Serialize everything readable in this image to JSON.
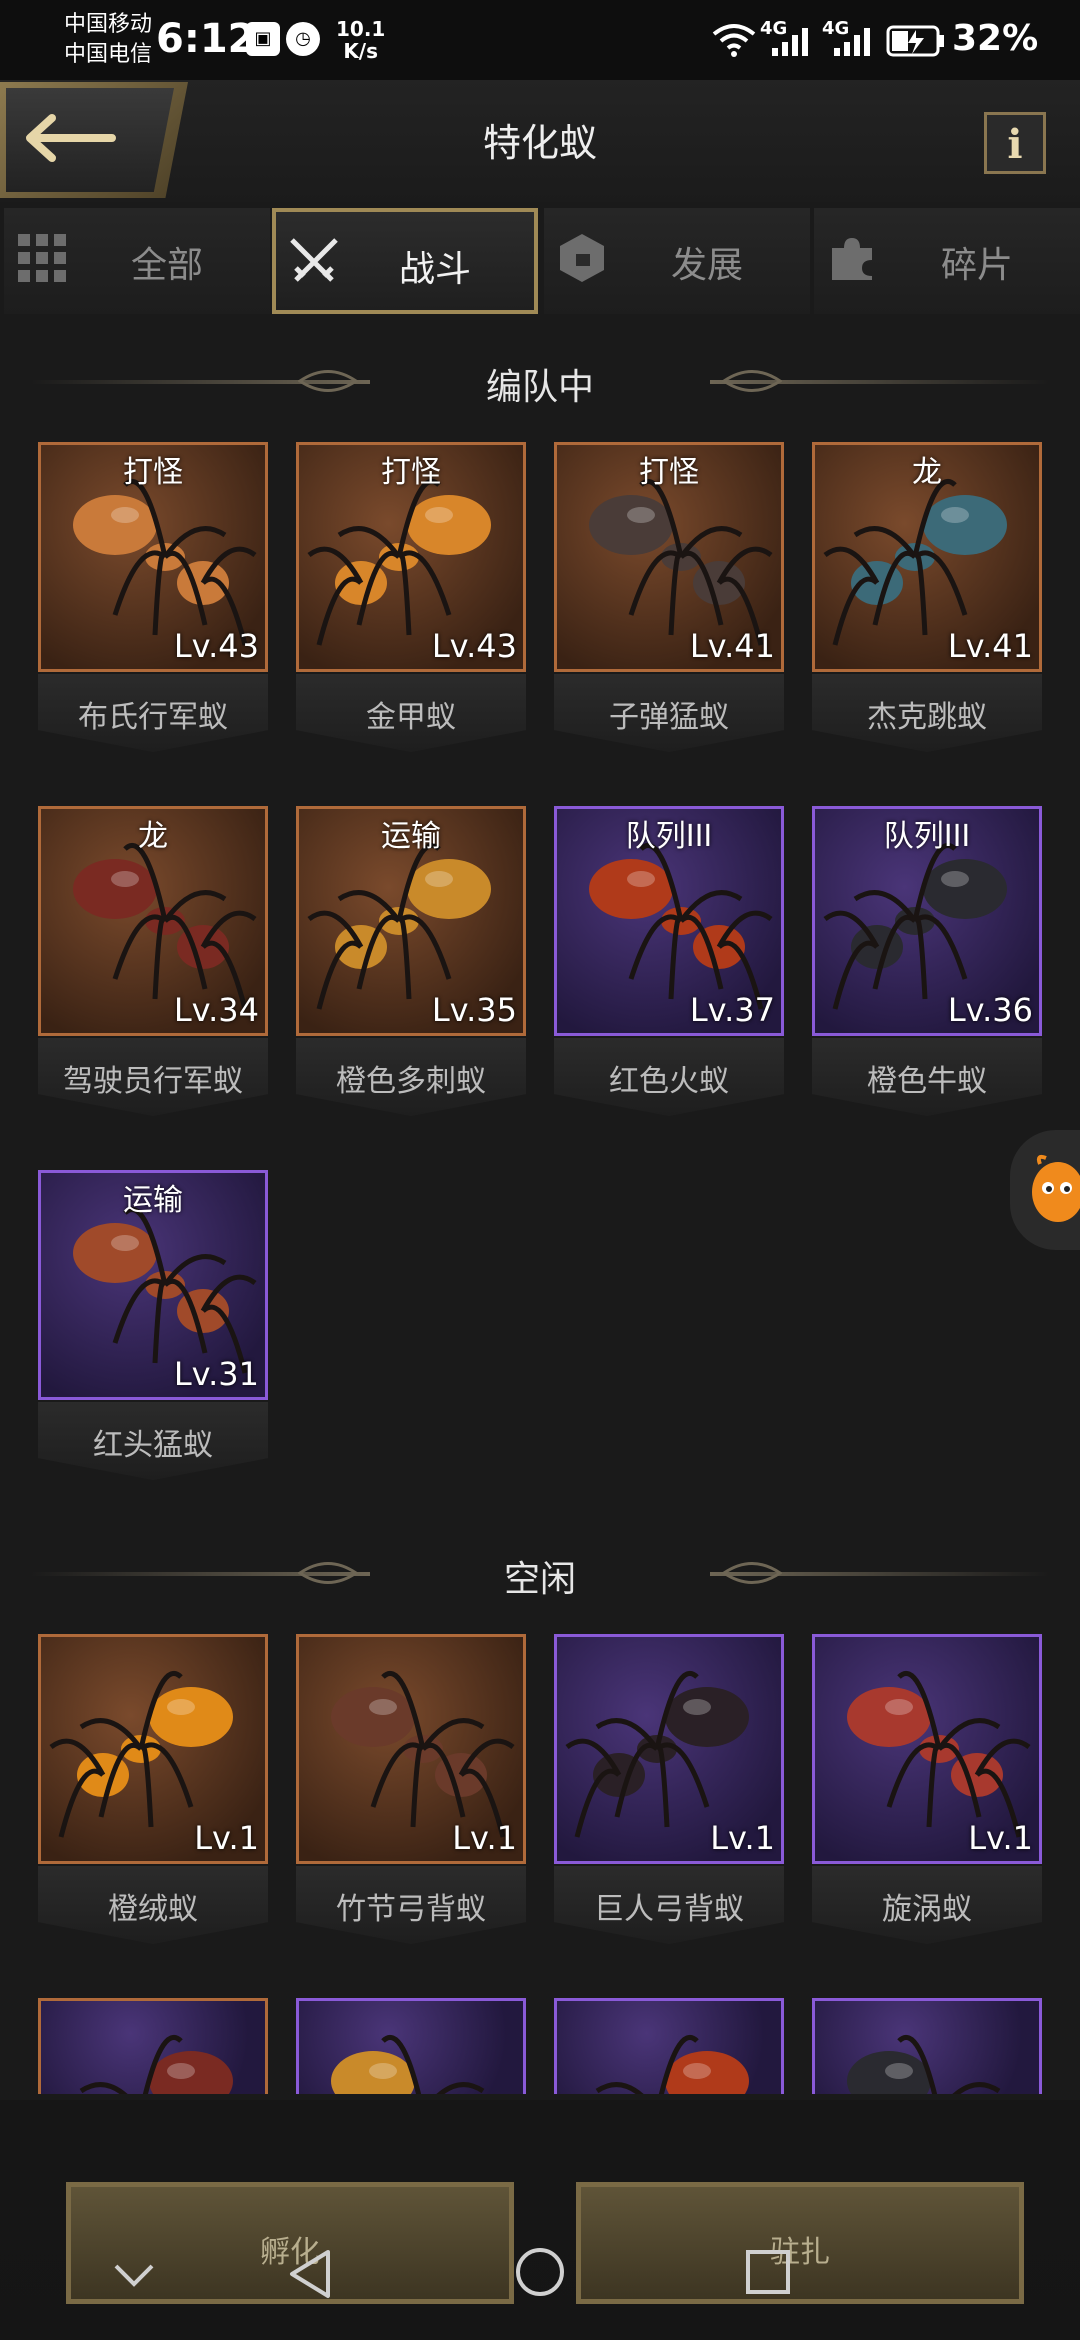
{
  "status_bar": {
    "carrier1": "中国移动",
    "carrier2": "中国电信",
    "time": "6:12",
    "net_speed_value": "10.1",
    "net_speed_unit": "K/s",
    "signal1": "4G",
    "signal2": "4G",
    "battery": "32%"
  },
  "header": {
    "title": "特化蚁",
    "info_label": "i"
  },
  "tabs": [
    {
      "label": "全部",
      "icon": "grid-icon",
      "active": false
    },
    {
      "label": "战斗",
      "icon": "crossed-swords-icon",
      "active": true
    },
    {
      "label": "发展",
      "icon": "hexagon-icon",
      "active": false
    },
    {
      "label": "碎片",
      "icon": "puzzle-icon",
      "active": false
    }
  ],
  "sections": {
    "in_team": "编队中",
    "idle": "空闲"
  },
  "team_ants": [
    {
      "tag": "打怪",
      "level": "Lv.43",
      "name": "布氏行军蚁",
      "rarity": "orange"
    },
    {
      "tag": "打怪",
      "level": "Lv.43",
      "name": "金甲蚁",
      "rarity": "orange"
    },
    {
      "tag": "打怪",
      "level": "Lv.41",
      "name": "子弹猛蚁",
      "rarity": "orange"
    },
    {
      "tag": "龙",
      "level": "Lv.41",
      "name": "杰克跳蚁",
      "rarity": "orange"
    },
    {
      "tag": "龙",
      "level": "Lv.34",
      "name": "驾驶员行军蚁",
      "rarity": "orange"
    },
    {
      "tag": "运输",
      "level": "Lv.35",
      "name": "橙色多刺蚁",
      "rarity": "orange"
    },
    {
      "tag": "队列III",
      "level": "Lv.37",
      "name": "红色火蚁",
      "rarity": "purple"
    },
    {
      "tag": "队列III",
      "level": "Lv.36",
      "name": "橙色牛蚁",
      "rarity": "purple"
    },
    {
      "tag": "运输",
      "level": "Lv.31",
      "name": "红头猛蚁",
      "rarity": "purple"
    }
  ],
  "idle_ants": [
    {
      "level": "Lv.1",
      "name": "橙绒蚁",
      "rarity": "orange"
    },
    {
      "level": "Lv.1",
      "name": "竹节弓背蚁",
      "rarity": "orange"
    },
    {
      "level": "Lv.1",
      "name": "巨人弓背蚁",
      "rarity": "purple"
    },
    {
      "level": "Lv.1",
      "name": "旋涡蚁",
      "rarity": "purple"
    }
  ],
  "buttons": {
    "hatch": "孵化",
    "station": "驻扎"
  },
  "colors": {
    "orange_border": "#b06a3a",
    "purple_border": "#8a5ad8",
    "gold_accent": "#a08a56"
  }
}
